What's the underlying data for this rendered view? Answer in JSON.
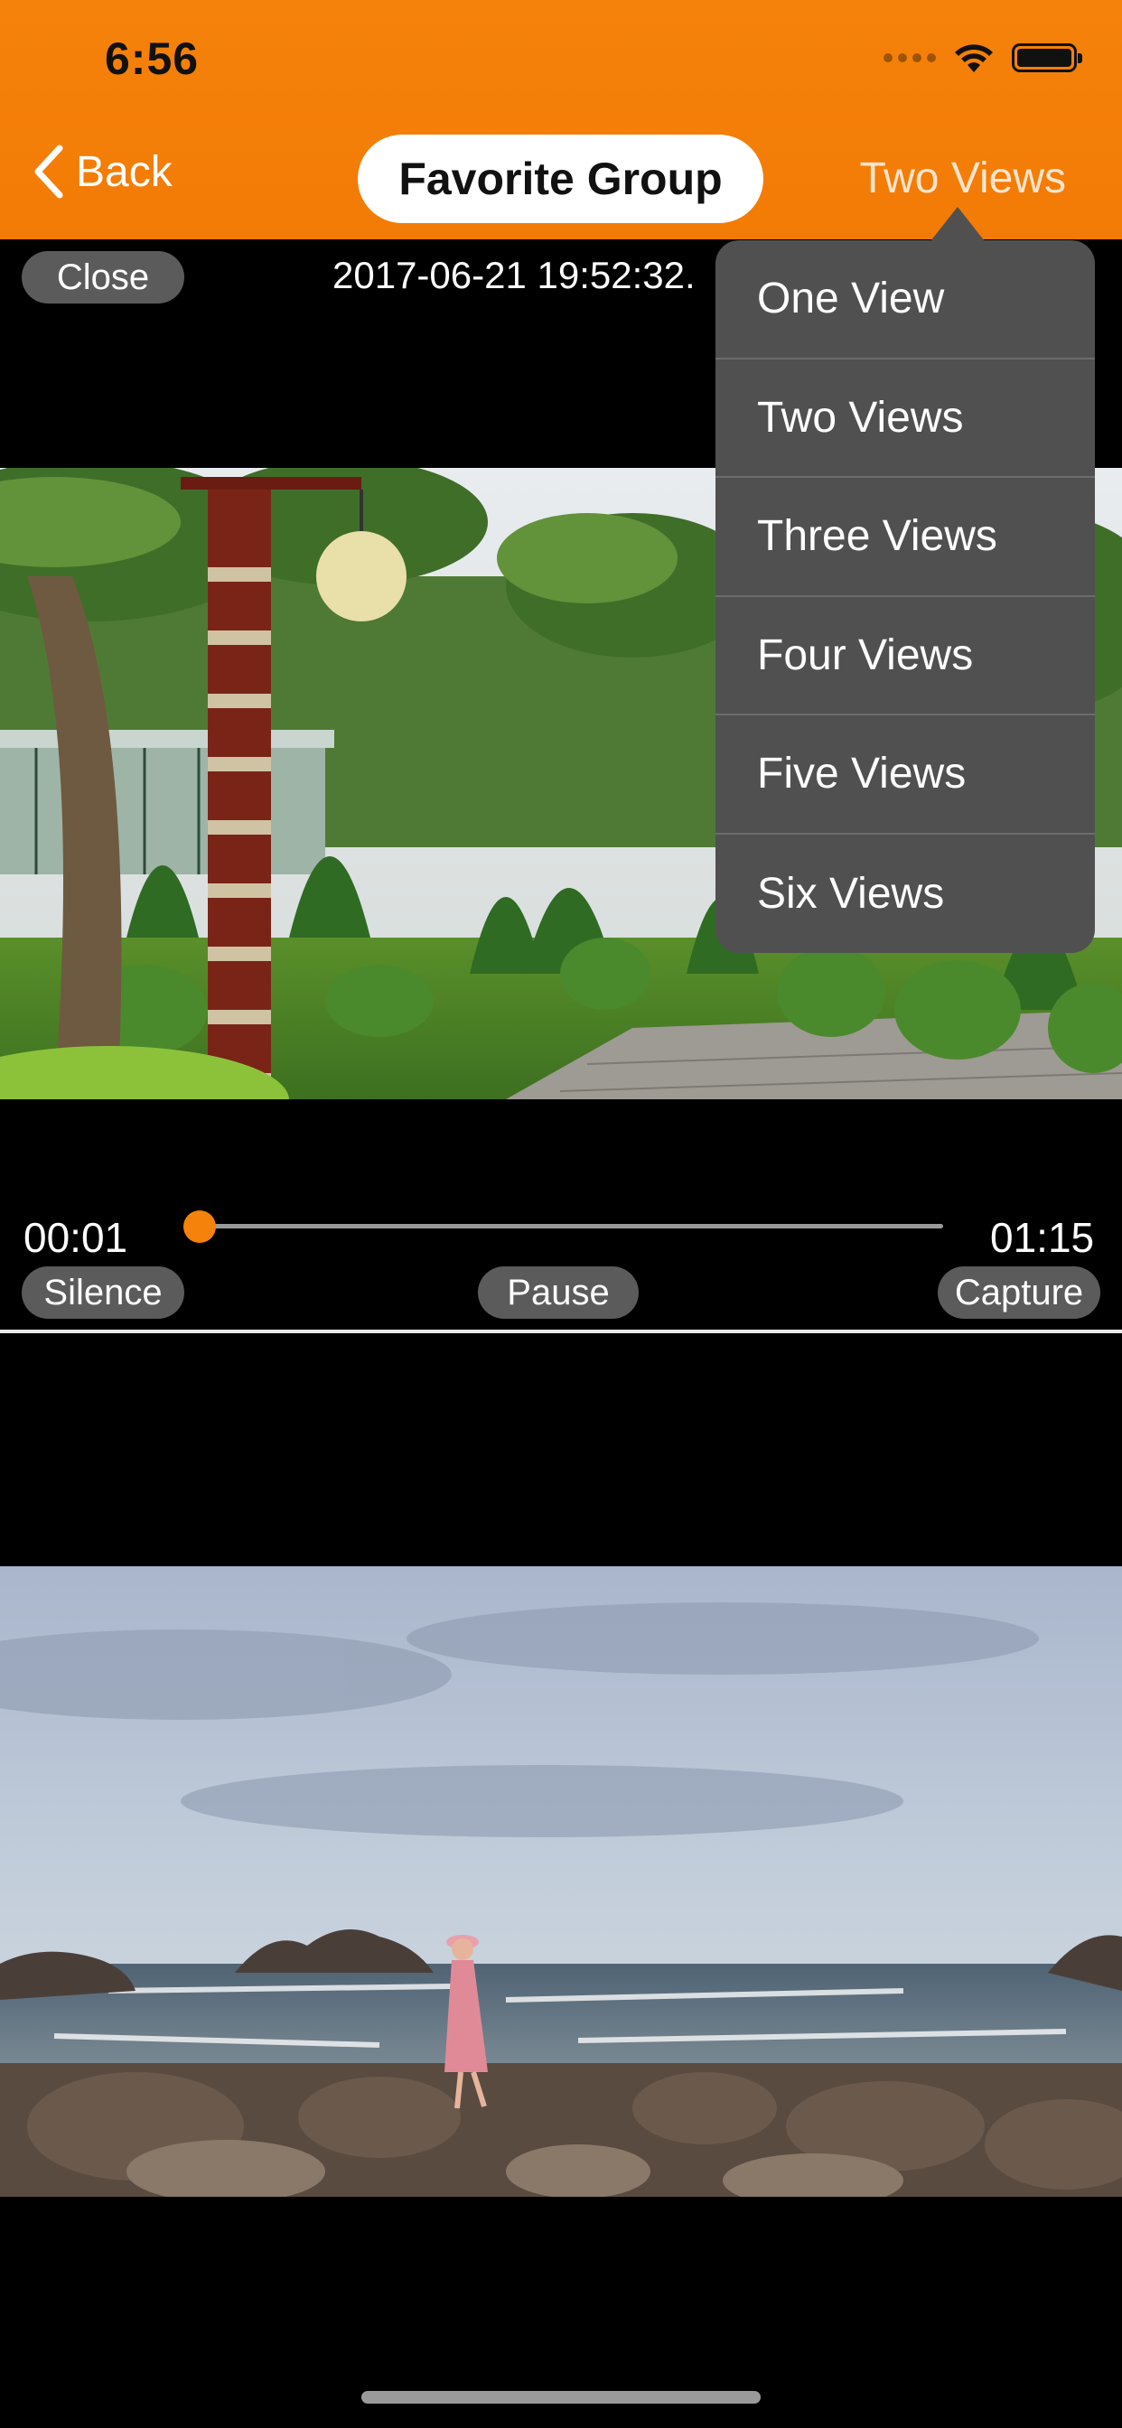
{
  "status_bar": {
    "time": "6:56",
    "icons": [
      "cellular-signal-icon",
      "wifi-icon",
      "battery-icon"
    ]
  },
  "nav": {
    "back_label": "Back",
    "title": "Favorite Group",
    "view_mode_label": "Two Views"
  },
  "player_top": {
    "close_label": "Close",
    "timestamp": "2017-06-21 19:52:32.",
    "current_time": "00:01",
    "total_time": "01:15",
    "progress": 0.02,
    "silence_label": "Silence",
    "pause_label": "Pause",
    "capture_label": "Capture"
  },
  "view_menu": {
    "items": [
      {
        "label": "One View"
      },
      {
        "label": "Two Views"
      },
      {
        "label": "Three Views"
      },
      {
        "label": "Four Views"
      },
      {
        "label": "Five Views"
      },
      {
        "label": "Six Views"
      }
    ]
  },
  "colors": {
    "accent": "#f5820a",
    "menu_bg": "#505050",
    "pill_bg": "#5b5b5b"
  }
}
